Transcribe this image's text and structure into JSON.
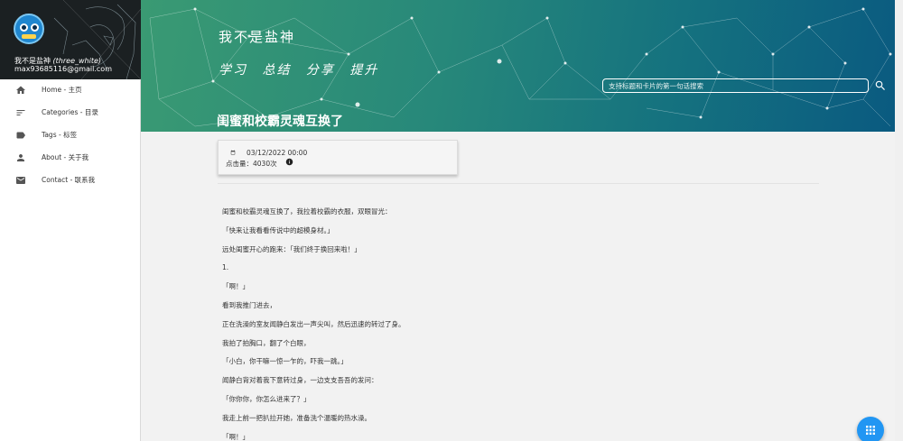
{
  "sidebar": {
    "user_name": "我不是盐神",
    "user_alias": "(three_white)",
    "user_email": "max93685116@gmail.com",
    "menu": [
      {
        "label": "Home - 主页",
        "icon": "home-icon"
      },
      {
        "label": "Categories - 目录",
        "icon": "list-icon"
      },
      {
        "label": "Tags - 标签",
        "icon": "tag-icon"
      },
      {
        "label": "About - 关于我",
        "icon": "person-icon"
      },
      {
        "label": "Contact - 联系我",
        "icon": "mail-icon"
      }
    ]
  },
  "header": {
    "site_title": "我不是盐神",
    "slogan": "学习 总结 分享 提升",
    "post_title": "闺蜜和校霸灵魂互换了",
    "search": {
      "placeholder": "支持标题和卡片的第一句话搜索",
      "icon": "search-icon"
    }
  },
  "meta": {
    "date": "03/12/2022 00:00",
    "views": "点击量：4030次",
    "date_icon": "calendar-icon",
    "info_icon": "info-icon"
  },
  "article": {
    "paragraphs": [
      "闺蜜和校霸灵魂互换了，我拉着校霸的衣服，双眼冒光：",
      "「快来让我看看传说中的超模身材。」",
      "远处闺蜜开心的跑来：「我们终于换回来啦！」",
      "1.",
      "「啊！」",
      "看到我推门进去，",
      "正在洗澡的室友闻静白发出一声尖叫，然后迅速的转过了身。",
      "我拍了拍胸口，翻了个白眼，",
      "「小白，你干嘛一惊一乍的，吓我一跳。」",
      "闻静白背对着我下意转过身，一边支支吾吾的发问：",
      "「你你你，你怎么进来了？」",
      "我走上前一把扒拉开她，准备洗个温暖的热水澡。",
      "「啊！」"
    ]
  },
  "fab": {
    "icon": "grid-menu-icon"
  },
  "colors": {
    "accent": "#2196f3",
    "banner_start": "#3a9a73",
    "banner_end": "#0a5a80"
  }
}
